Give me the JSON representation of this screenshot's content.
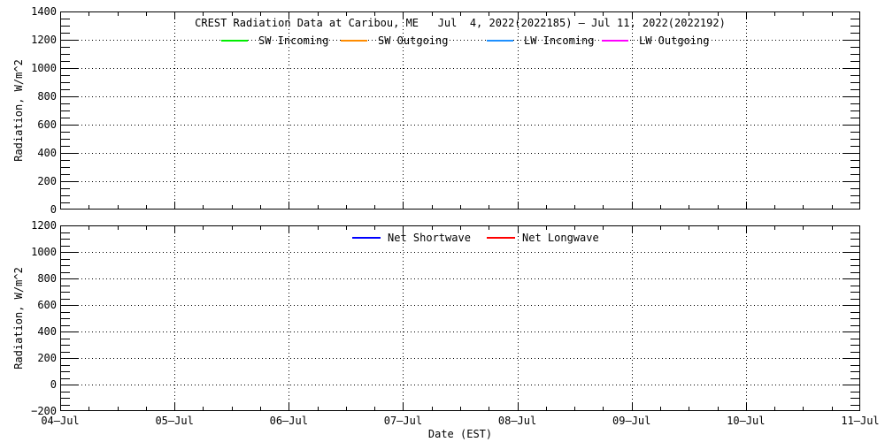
{
  "window": {
    "background": "#ffffff",
    "frame_color": "#000000"
  },
  "chart_data": [
    {
      "type": "line",
      "panel": "radiation-components",
      "title": "CREST Radiation Data at Caribou, ME   Jul  4, 2022(2022185) — Jul 11, 2022(2022192)",
      "ylabel": "Radiation, W/m^2",
      "ylim": [
        0,
        1400
      ],
      "ytick_interval": 200,
      "yminor_interval": 50,
      "ytick_labels": [
        "0",
        "200",
        "400",
        "600",
        "800",
        "1000",
        "1200",
        "1400"
      ],
      "x_categories": [
        "04—Jul",
        "05—Jul",
        "06—Jul",
        "07—Jul",
        "08—Jul",
        "09—Jul",
        "10—Jul",
        "11—Jul"
      ],
      "xminor_per_major": 4,
      "grid": "dotted lines at every major x and y tick",
      "legend_position": "inside-top",
      "series": [
        {
          "name": "SW Incoming",
          "color": "#00ee00",
          "values": []
        },
        {
          "name": "SW Outgoing",
          "color": "#ff8c00",
          "values": []
        },
        {
          "name": "LW Incoming",
          "color": "#1e90ff",
          "values": []
        },
        {
          "name": "LW Outgoing",
          "color": "#ff00ff",
          "values": []
        }
      ],
      "visible_series_data": "none plotted (empty axes with legend only)"
    },
    {
      "type": "line",
      "panel": "net-radiation",
      "xlabel": "Date (EST)",
      "ylabel": "Radiation, W/m^2",
      "ylim": [
        -200,
        1200
      ],
      "ytick_interval": 200,
      "yminor_interval": 50,
      "ytick_labels": [
        "−200",
        "0",
        "200",
        "400",
        "600",
        "800",
        "1000",
        "1200"
      ],
      "x_categories": [
        "04—Jul",
        "05—Jul",
        "06—Jul",
        "07—Jul",
        "08—Jul",
        "09—Jul",
        "10—Jul",
        "11—Jul"
      ],
      "xminor_per_major": 4,
      "grid": "dotted lines at every major x and y tick",
      "legend_position": "inside-top",
      "series": [
        {
          "name": "Net Shortwave",
          "color": "#0000ff",
          "values": []
        },
        {
          "name": "Net Longwave",
          "color": "#ff0000",
          "values": []
        }
      ],
      "visible_series_data": "none plotted (empty axes with legend only)"
    }
  ]
}
